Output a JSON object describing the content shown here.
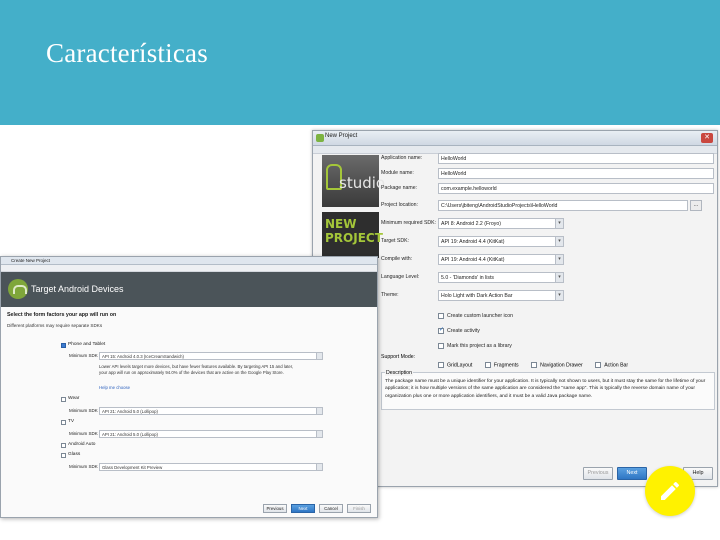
{
  "slide": {
    "title": "Características"
  },
  "new_project": {
    "window_title": "New Project",
    "logo_text": "studio",
    "banner": [
      "NEW",
      "PROJECT"
    ],
    "fields": [
      {
        "label": "Application name:",
        "value": "HelloWorld",
        "kind": "text"
      },
      {
        "label": "Module name:",
        "value": "HelloWorld",
        "kind": "text"
      },
      {
        "label": "Package name:",
        "value": "com.example.helloworld",
        "kind": "text"
      },
      {
        "label": "Project location:",
        "value": "C:\\Users\\jbiteng\\AndroidStudioProjects\\HelloWorld",
        "kind": "path",
        "browse": "..."
      },
      {
        "label": "Minimum required SDK:",
        "value": "API 8: Android 2.2 (Froyo)",
        "kind": "select"
      },
      {
        "label": "Target SDK:",
        "value": "API 19: Android 4.4 (KitKat)",
        "kind": "select"
      },
      {
        "label": "Compile with:",
        "value": "API 19: Android 4.4 (KitKat)",
        "kind": "select"
      },
      {
        "label": "Language Level:",
        "value": "5.0 - 'Diamonds' in lists",
        "kind": "select"
      },
      {
        "label": "Theme:",
        "value": "Holo Light with Dark Action Bar",
        "kind": "select"
      }
    ],
    "checkboxes": [
      {
        "label": "Create custom launcher icon",
        "checked": false
      },
      {
        "label": "Create activity",
        "checked": true
      },
      {
        "label": "Mark this project as a library",
        "checked": false
      }
    ],
    "support_modes": {
      "label": "Support Mode:",
      "options": [
        "GridLayout",
        "Fragments",
        "Navigation Drawer",
        "Action Bar"
      ]
    },
    "description": {
      "label": "Description",
      "text": "The package name must be a unique identifier for your application. It is typically not shown to users, but it must stay the same for the lifetime of your application; it is how multiple versions of the same application are considered the \"same app\". This is typically the reverse domain name of your organization plus one or more application identifiers, and it must be a valid Java package name."
    },
    "buttons": {
      "previous": "Previous",
      "next": "Next",
      "help": "Help"
    }
  },
  "target_devices": {
    "window_title": "Create New Project",
    "header_title": "Target Android Devices",
    "intro": "Select the form factors your app will run on",
    "sub": "Different platforms may require separate SDKs",
    "min_sdk_label": "Minimum SDK",
    "factors": [
      {
        "label": "Phone and Tablet",
        "checked": true,
        "sdk": "API 15: Android 4.0.3 (IceCreamSandwich)"
      },
      {
        "label": "Wear",
        "checked": false,
        "sdk": "API 21: Android 5.0 (Lollipop)"
      },
      {
        "label": "TV",
        "checked": false,
        "sdk": "API 21: Android 5.0 (Lollipop)"
      },
      {
        "label": "Android Auto",
        "checked": false,
        "sdk": ""
      },
      {
        "label": "Glass",
        "checked": false,
        "sdk": "Glass Development Kit Preview"
      }
    ],
    "note": "Lower API levels target more devices, but have fewer features available. By targeting API 15 and later, your app will run on approximately 94.0% of the devices that are active on the Google Play Store.",
    "help_link": "Help me choose",
    "buttons": {
      "previous": "Previous",
      "next": "Next",
      "cancel": "Cancel",
      "finish": "Finish"
    }
  },
  "fab": {
    "icon": "pencil-icon",
    "color": "#fff200"
  }
}
